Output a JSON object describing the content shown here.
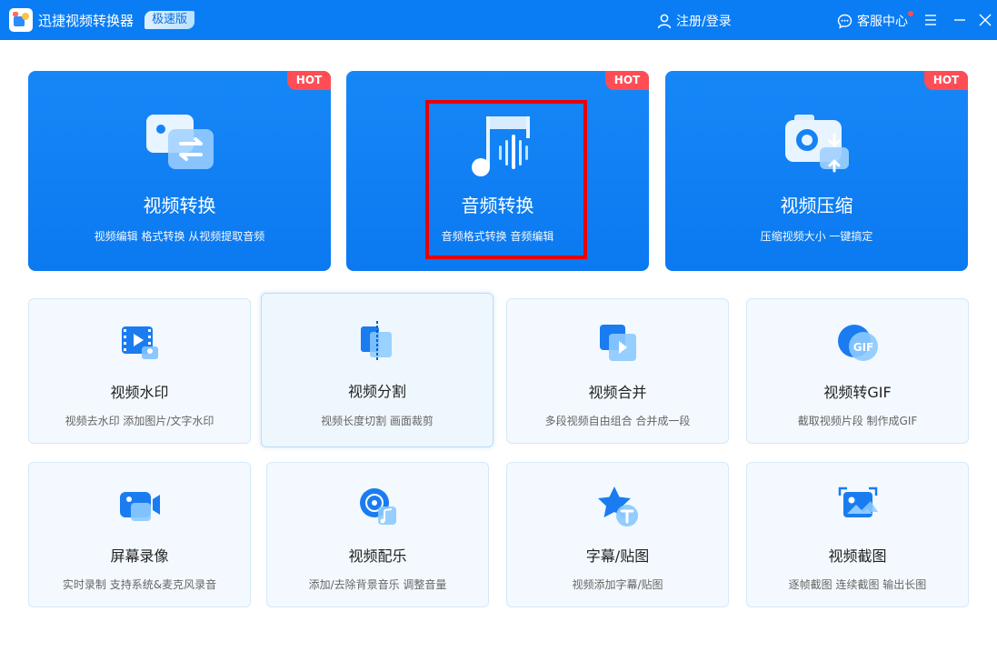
{
  "titlebar": {
    "app_title": "迅捷视频转换器",
    "edition": "极速版",
    "login": "注册/登录",
    "service": "客服中心"
  },
  "big_cards": [
    {
      "title": "视频转换",
      "desc": "视频编辑 格式转换 从视频提取音频",
      "badge": "HOT"
    },
    {
      "title": "音频转换",
      "desc": "音频格式转换 音频编辑",
      "badge": "HOT"
    },
    {
      "title": "视频压缩",
      "desc": "压缩视频大小 一键搞定",
      "badge": "HOT"
    }
  ],
  "small_cards": [
    {
      "title": "视频水印",
      "desc": "视频去水印 添加图片/文字水印"
    },
    {
      "title": "视频分割",
      "desc": "视频长度切割 画面裁剪"
    },
    {
      "title": "视频合并",
      "desc": "多段视频自由组合 合并成一段"
    },
    {
      "title": "视频转GIF",
      "desc": "截取视频片段 制作成GIF"
    },
    {
      "title": "屏幕录像",
      "desc": "实时录制 支持系统&麦克风录音"
    },
    {
      "title": "视频配乐",
      "desc": "添加/去除背景音乐 调整音量"
    },
    {
      "title": "字幕/贴图",
      "desc": "视频添加字幕/贴图"
    },
    {
      "title": "视频截图",
      "desc": "逐帧截图 连续截图 输出长图"
    }
  ],
  "icons": {
    "gif_label": "GIF"
  },
  "colors": {
    "titlebar": "#0a7df5",
    "card": "#0b79f0",
    "hot": "#ff4d55",
    "highlight": "#e6000a"
  }
}
